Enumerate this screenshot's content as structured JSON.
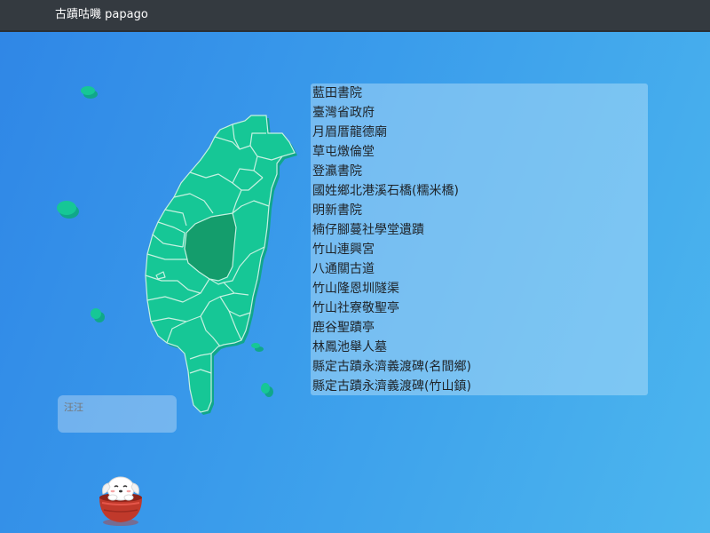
{
  "navbar": {
    "brand": "古蹟咕嘰 papago"
  },
  "sites": [
    "藍田書院",
    "臺灣省政府",
    "月眉厝龍德廟",
    "草屯燉倫堂",
    "登瀛書院",
    "國姓鄉北港溪石橋(糯米橋)",
    "明新書院",
    "楠仔腳蔓社學堂遺蹟",
    "竹山連興宮",
    "八通關古道",
    "竹山隆恩圳隧渠",
    "竹山社寮敬聖亭",
    "鹿谷聖蹟亭",
    "林鳳池舉人墓",
    "縣定古蹟永濟義渡碑(名間鄉)",
    "縣定古蹟永濟義渡碑(竹山鎮)"
  ],
  "chat": {
    "placeholder": "汪汪"
  },
  "map": {
    "highlighted_county": "南投縣"
  },
  "colors": {
    "island": "#16c796",
    "island_shadow": "#10a78a",
    "highlight": "#149d6c",
    "border": "#b9ecd9",
    "navbar": "#343a40"
  }
}
